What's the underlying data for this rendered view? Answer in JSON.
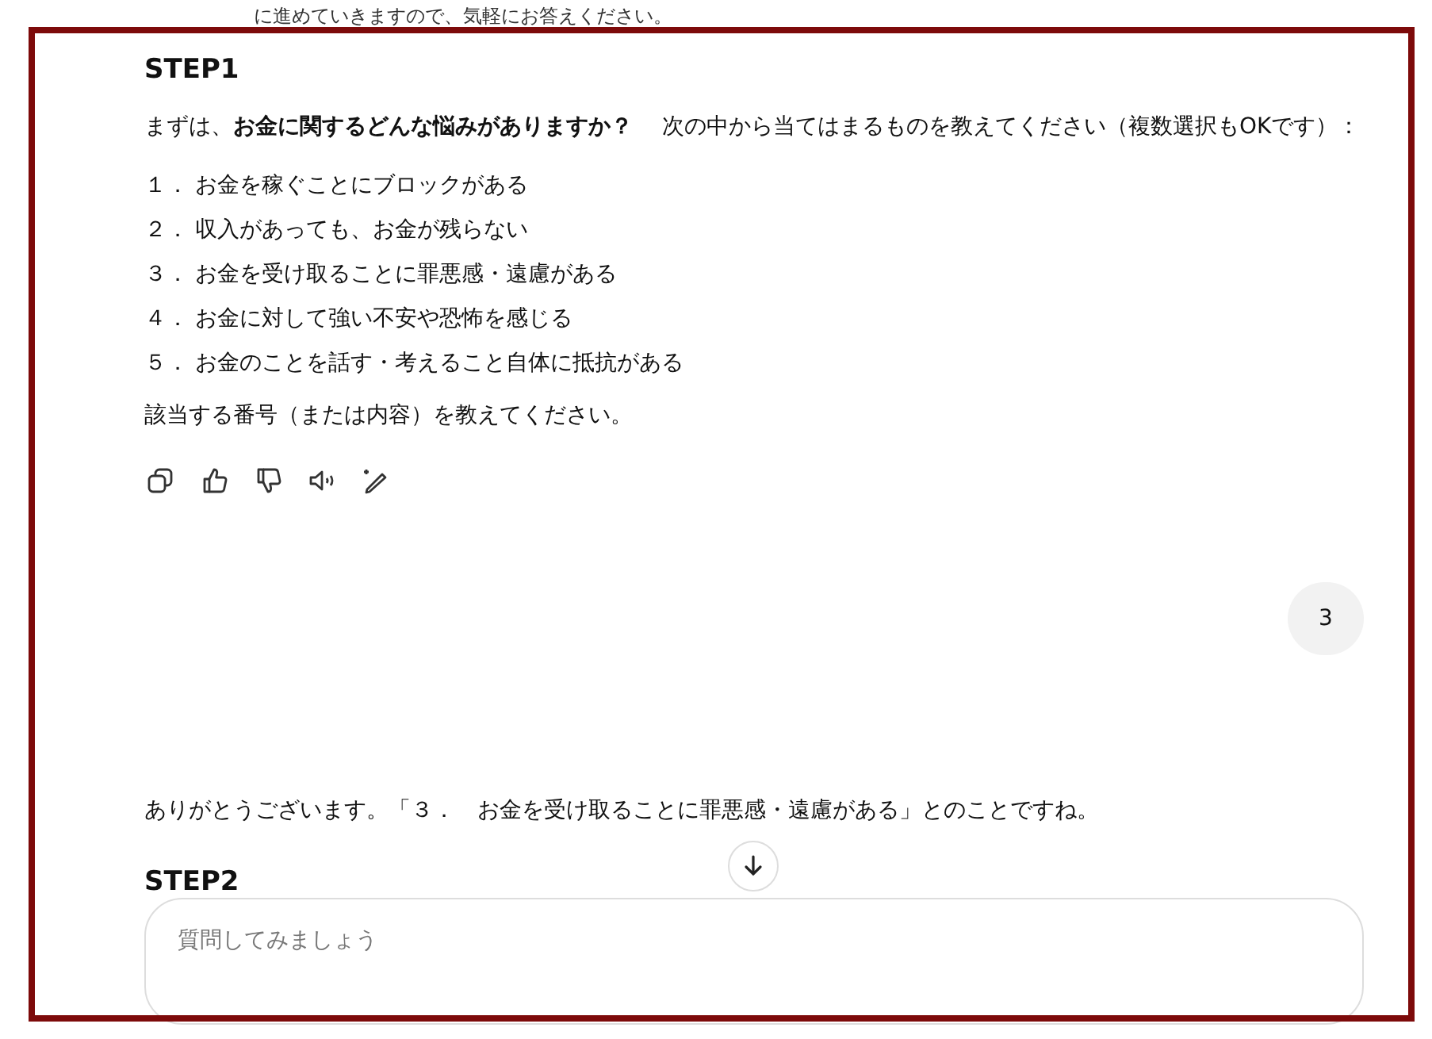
{
  "previous_text": "に進めていきますので、気軽にお答えください。",
  "assistant_message": {
    "heading": "STEP1",
    "intro": "まずは、**お金に関するどんな悩みがありますか？**　 次の中から当てはまるものを教えてください（複数選択もOKです）：",
    "options": [
      {
        "number": "１．",
        "text": "お金を稼ぐことにブロックがある"
      },
      {
        "number": "２．",
        "text": "収入があっても、お金が残らない"
      },
      {
        "number": "３．",
        "text": "お金を受け取ることに罪悪感・遠慮がある"
      },
      {
        "number": "４．",
        "text": "お金に対して強い不安や恐怖を感じる"
      },
      {
        "number": "５．",
        "text": "お金のことを話す・考えること自体に抵抗がある"
      }
    ],
    "closing": "該当する番号（または内容）を教えてください。"
  },
  "user_message": "3",
  "reply": {
    "text": "ありがとうございます。「３．　お金を受け取ることに罪悪感・遠慮がある」とのことですね。",
    "heading": "STEP2"
  },
  "composer": {
    "placeholder": "質問してみましょう"
  }
}
